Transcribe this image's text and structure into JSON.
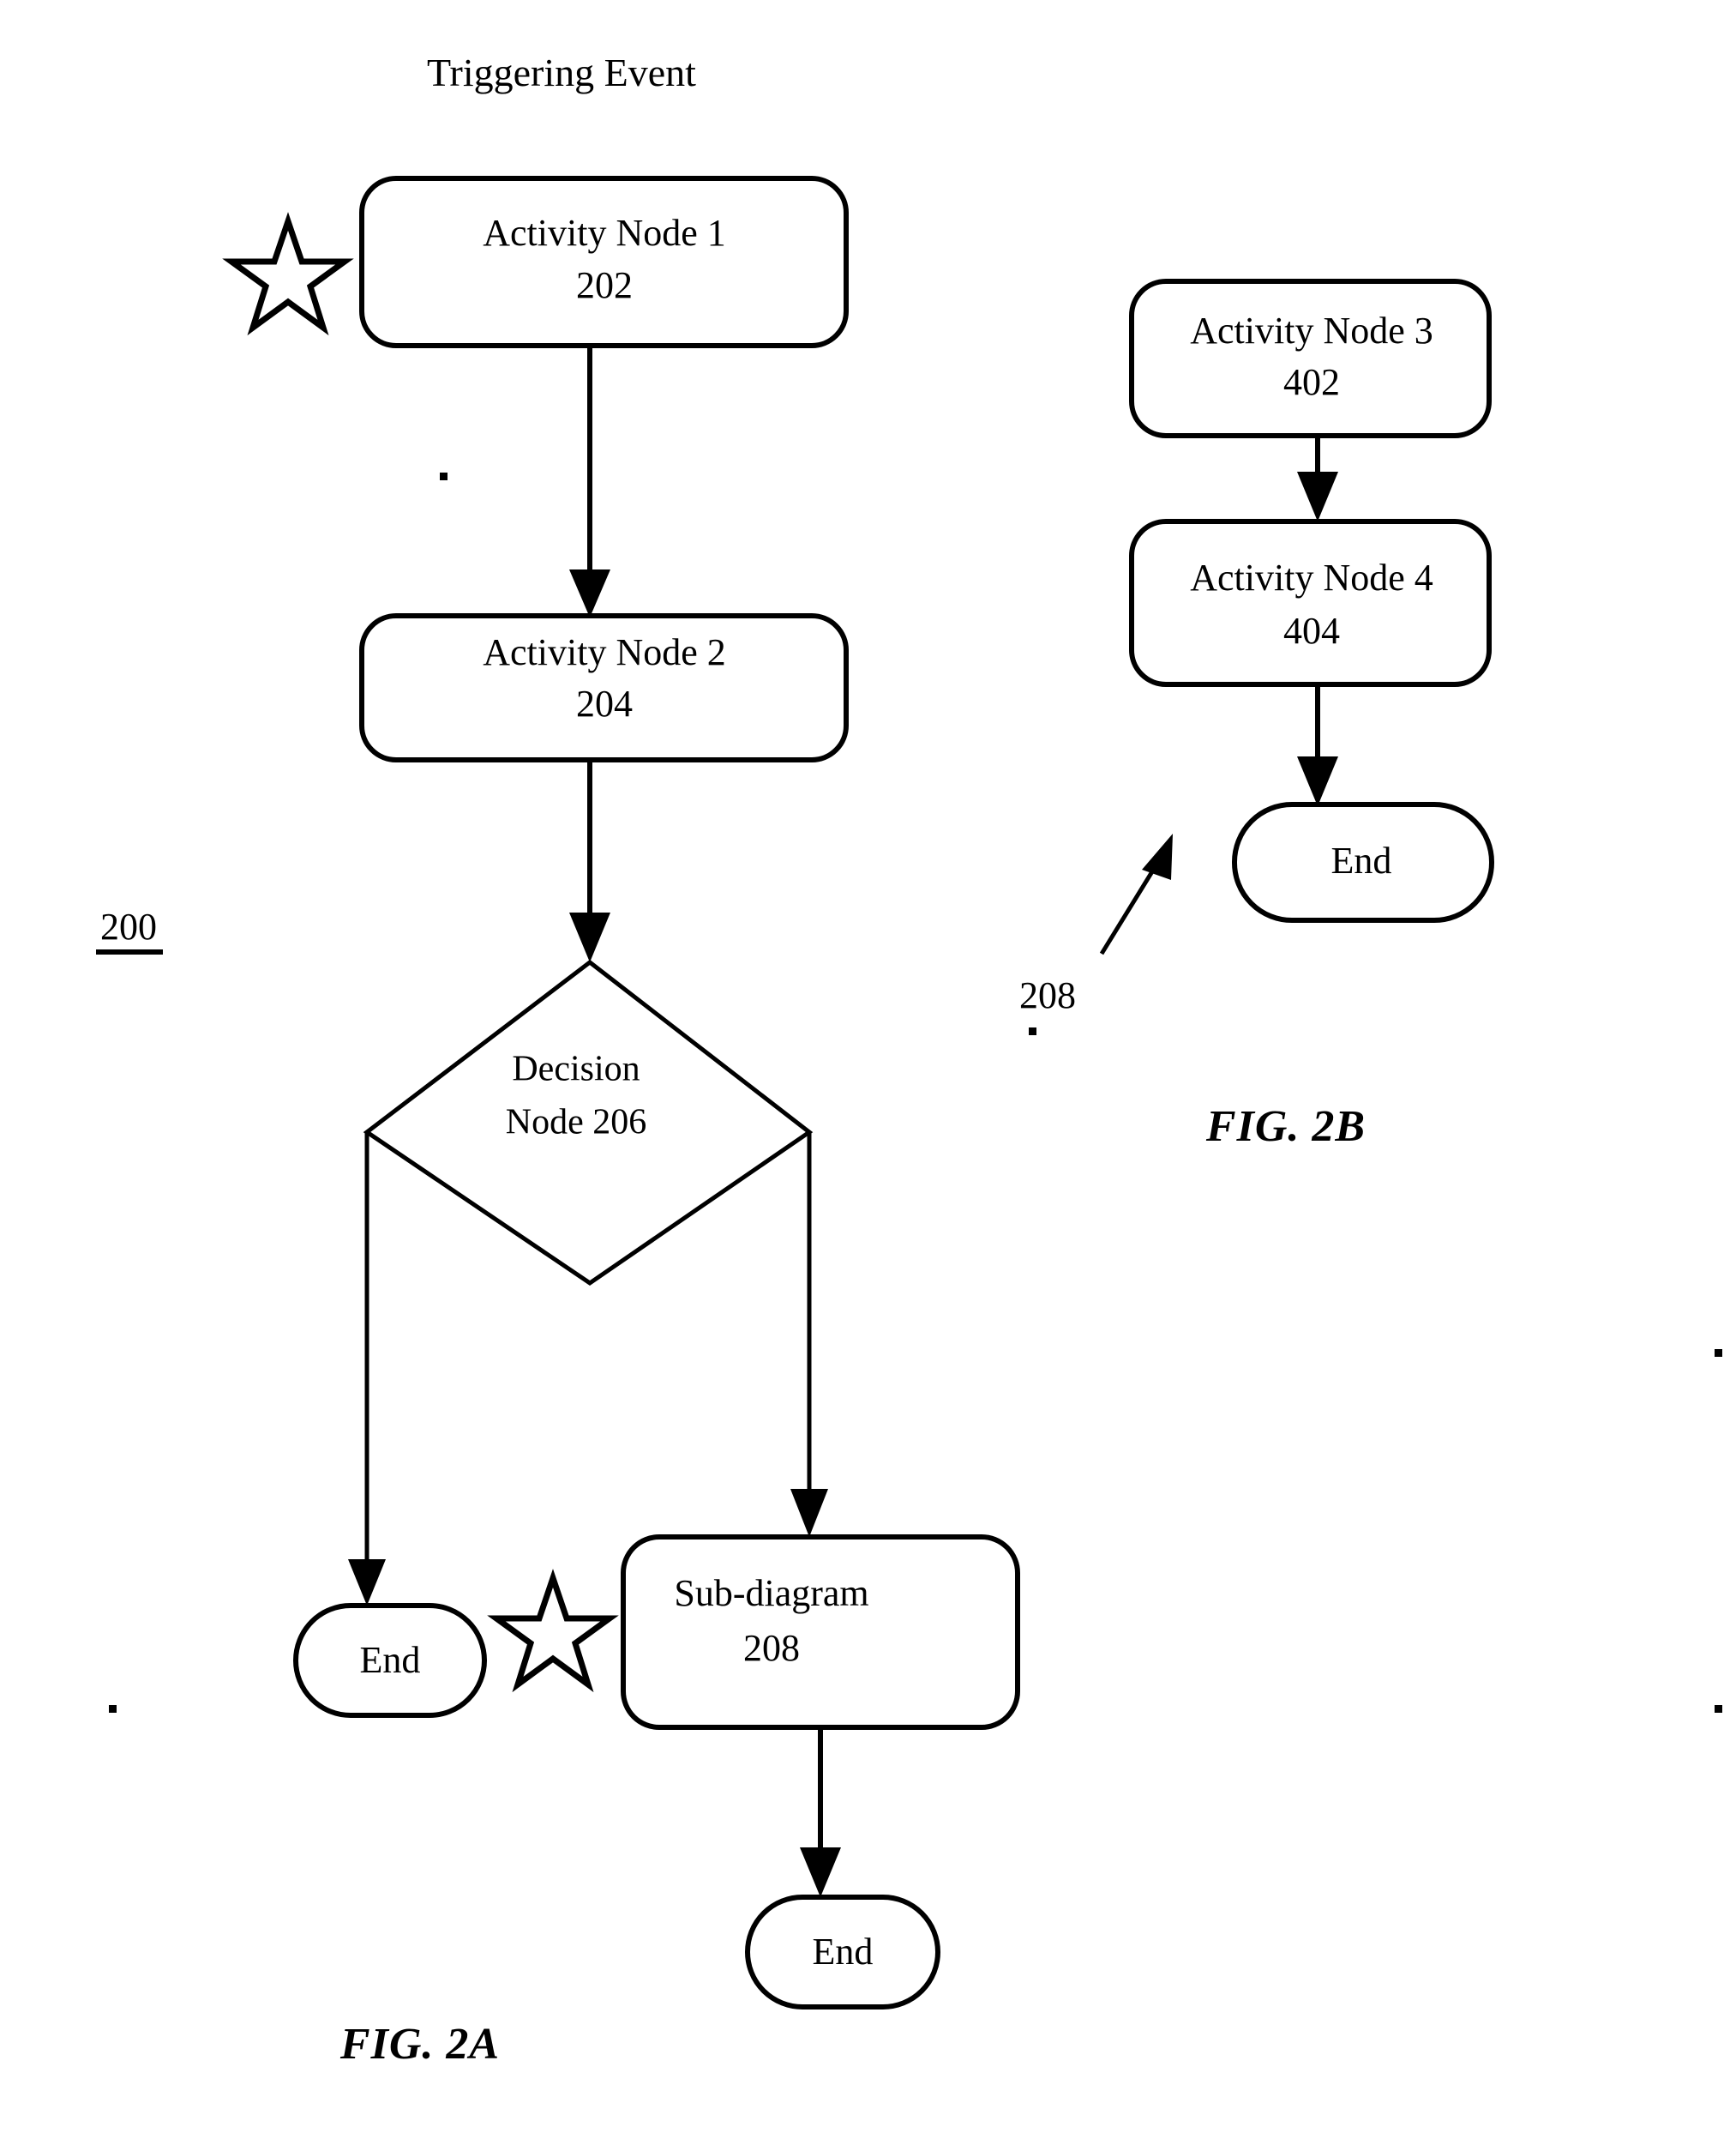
{
  "figure": {
    "page_heading": "Triggering Event",
    "diagram_ref": "200"
  },
  "fig_2a": {
    "label": "FIG. 2A",
    "nodes": [
      {
        "id": "activity-node-1",
        "shape": "rounded-rect",
        "title": "Activity Node 1",
        "ref": "202"
      },
      {
        "id": "activity-node-2",
        "shape": "rounded-rect",
        "title": "Activity Node 2",
        "ref": "204"
      },
      {
        "id": "decision-node",
        "shape": "diamond",
        "title": "Decision",
        "ref": "Node 206"
      },
      {
        "id": "end-left",
        "shape": "stadium",
        "title": "End",
        "ref": ""
      },
      {
        "id": "sub-diagram",
        "shape": "rounded-rect",
        "title": "Sub-diagram",
        "ref": "208"
      },
      {
        "id": "end-bottom",
        "shape": "stadium",
        "title": "End",
        "ref": ""
      }
    ],
    "markers": [
      {
        "id": "star-activity-node-1",
        "icon": "star-icon"
      },
      {
        "id": "star-sub-diagram",
        "icon": "star-icon"
      }
    ]
  },
  "fig_2b": {
    "label": "FIG. 2B",
    "nodes": [
      {
        "id": "activity-node-3",
        "shape": "rounded-rect",
        "title": "Activity Node 3",
        "ref": "402"
      },
      {
        "id": "activity-node-4",
        "shape": "rounded-rect",
        "title": "Activity Node 4",
        "ref": "404"
      },
      {
        "id": "end-2b",
        "shape": "stadium",
        "title": "End",
        "ref": ""
      }
    ],
    "callout": {
      "id": "callout-208",
      "ref": "208",
      "icon": "leader-arrow-icon"
    }
  },
  "colors": {
    "ink": "#000000",
    "paper": "#ffffff"
  }
}
